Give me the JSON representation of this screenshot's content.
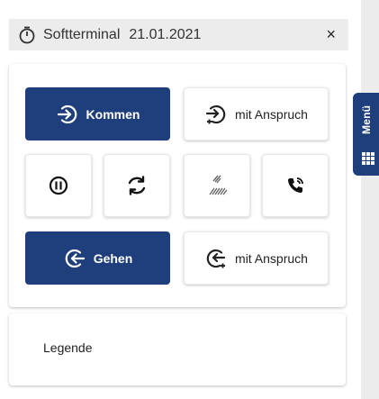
{
  "header": {
    "icon": "stopwatch-icon",
    "title": "Softterminal",
    "date": "21.01.2021",
    "close_label": "×"
  },
  "side_tab": {
    "label": "Menü",
    "icon": "grid-icon"
  },
  "actions": {
    "kommen_label": "Kommen",
    "kommen_anspruch_label": "mit Anspruch",
    "gehen_label": "Gehen",
    "gehen_anspruch_label": "mit Anspruch",
    "icons": [
      "login-icon",
      "login-plus-icon",
      "pause-icon",
      "refresh-icon",
      "hatch-icon",
      "phone-icon",
      "logout-icon",
      "logout-plus-icon"
    ]
  },
  "legend": {
    "label": "Legende"
  },
  "colors": {
    "primary": "#1f3f7c",
    "header_bg": "#ececec",
    "card_bg": "#ffffff"
  }
}
